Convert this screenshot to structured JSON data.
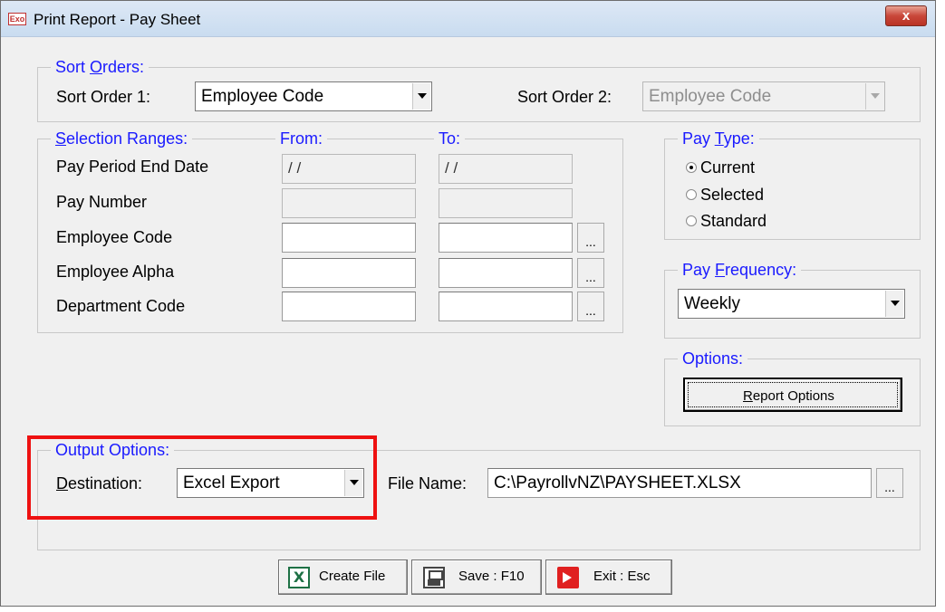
{
  "window": {
    "title": "Print Report - Pay Sheet",
    "app_icon": "Exo",
    "close_glyph": "x"
  },
  "sort_orders": {
    "label_main": "Sort ",
    "label_underlined": "O",
    "label_rest": "rders:",
    "order1_label": "Sort Order 1:",
    "order1_value": "Employee Code",
    "order2_label": "Sort Order 2:",
    "order2_value": "Employee Code"
  },
  "selection_ranges": {
    "label_underlined": "S",
    "label_rest": "election Ranges:",
    "from_label": "From:",
    "to_label": "To:",
    "rows": [
      {
        "label": "Pay Period End Date",
        "from": "/ /",
        "to": "/ /"
      },
      {
        "label": "Pay Number",
        "from": "",
        "to": ""
      },
      {
        "label": "Employee Code",
        "from": "",
        "to": ""
      },
      {
        "label": "Employee Alpha",
        "from": "",
        "to": ""
      },
      {
        "label": "Department Code",
        "from": "",
        "to": ""
      }
    ],
    "lookup_glyph": "..."
  },
  "pay_type": {
    "label_main": "Pay ",
    "label_underlined": "T",
    "label_rest": "ype:",
    "options": [
      {
        "label": "Current",
        "selected": true
      },
      {
        "label": "Selected",
        "selected": false
      },
      {
        "label": "Standard",
        "selected": false
      }
    ]
  },
  "pay_frequency": {
    "label_main": "Pay ",
    "label_underlined": "F",
    "label_rest": "requency:",
    "value": "Weekly"
  },
  "options": {
    "label": "Options:",
    "report_options_underlined": "R",
    "report_options_rest": "eport Options"
  },
  "output_options": {
    "label": "Output Options:",
    "destination_underlined": "D",
    "destination_rest": "estination:",
    "destination_value": "Excel Export",
    "file_name_label": "File Name:",
    "file_name_value": "C:\\PayrollvNZ\\PAYSHEET.XLSX",
    "lookup_glyph": "..."
  },
  "buttons": {
    "create_file": "Create File",
    "save": "Save : F10",
    "exit": "Exit : Esc"
  },
  "colors": {
    "group_label": "#1a1aff",
    "highlight": "#ee1111",
    "window_bg": "#f0f0f0"
  }
}
